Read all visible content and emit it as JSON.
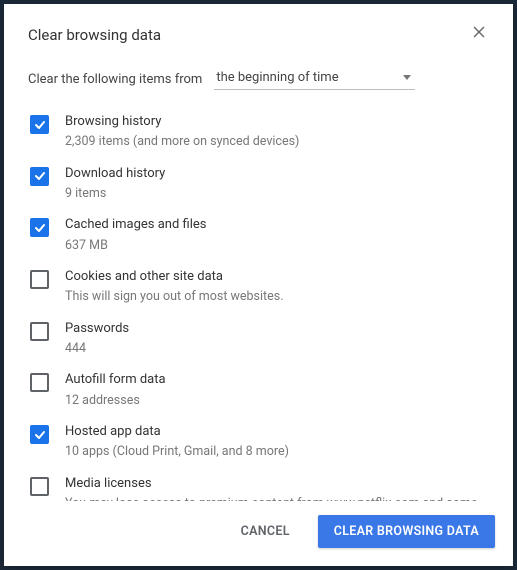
{
  "dialog": {
    "title": "Clear browsing data",
    "range_label": "Clear the following items from",
    "range_value": "the beginning of time",
    "options": [
      {
        "title": "Browsing history",
        "sub": "2,309 items (and more on synced devices)",
        "checked": true
      },
      {
        "title": "Download history",
        "sub": "9 items",
        "checked": true
      },
      {
        "title": "Cached images and files",
        "sub": "637 MB",
        "checked": true
      },
      {
        "title": "Cookies and other site data",
        "sub": "This will sign you out of most websites.",
        "checked": false
      },
      {
        "title": "Passwords",
        "sub": "444",
        "checked": false
      },
      {
        "title": "Autofill form data",
        "sub": "12 addresses",
        "checked": false
      },
      {
        "title": "Hosted app data",
        "sub": "10 apps (Cloud Print, Gmail, and 8 more)",
        "checked": true
      },
      {
        "title": "Media licenses",
        "sub": "You may lose access to premium content from www.netflix.com and some other sites.",
        "checked": false
      }
    ],
    "buttons": {
      "cancel": "Cancel",
      "confirm": "Clear browsing data"
    }
  }
}
